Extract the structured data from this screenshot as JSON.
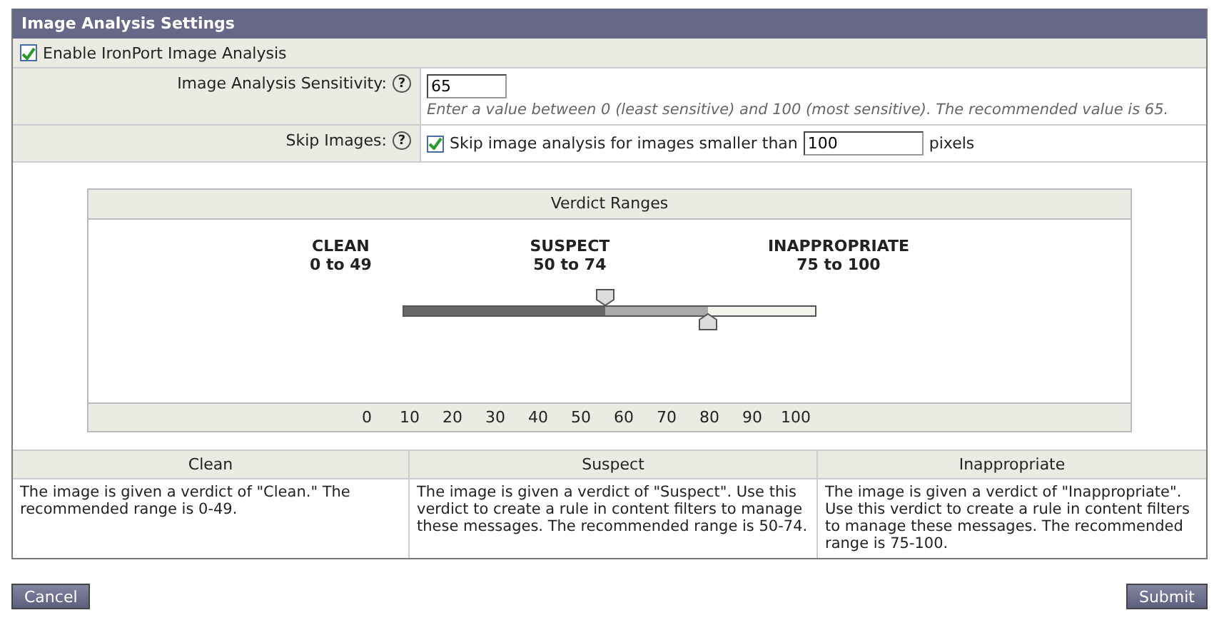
{
  "panel": {
    "title": "Image Analysis Settings"
  },
  "enable": {
    "label": "Enable IronPort Image Analysis",
    "checked": true
  },
  "sensitivity": {
    "label": "Image Analysis Sensitivity:",
    "help": "?",
    "value": "65",
    "hint": "Enter a value between 0 (least sensitive) and 100 (most sensitive). The recommended value is 65."
  },
  "skip": {
    "label": "Skip Images:",
    "help": "?",
    "checked": true,
    "text": "Skip image analysis for images smaller than",
    "value": "100",
    "unit": "pixels"
  },
  "verdict_ranges": {
    "title": "Verdict Ranges",
    "ranges": [
      {
        "name": "CLEAN",
        "range": "0 to 49"
      },
      {
        "name": "SUSPECT",
        "range": "50 to 74"
      },
      {
        "name": "INAPPROPRIATE",
        "range": "75 to 100"
      }
    ],
    "handles": [
      {
        "level": 0.49
      },
      {
        "level": 0.74
      }
    ],
    "scale": [
      "0",
      "10",
      "20",
      "30",
      "40",
      "50",
      "60",
      "70",
      "80",
      "90",
      "100"
    ]
  },
  "table": {
    "columns": [
      "Clean",
      "Suspect",
      "Inappropriate"
    ],
    "rows": [
      [
        "The image is given a verdict of \"Clean.\" The recommended range is 0-49.",
        "The image is given a verdict of \"Suspect\". Use this verdict to create a rule in content filters to manage these messages. The recommended range is 50-74.",
        "The image is given a verdict of \"Inappropriate\". Use this verdict to create a rule in content filters to manage these messages. The recommended range is 75-100."
      ]
    ]
  },
  "buttons": [
    {
      "label": "Cancel"
    },
    {
      "label": "Submit"
    }
  ]
}
